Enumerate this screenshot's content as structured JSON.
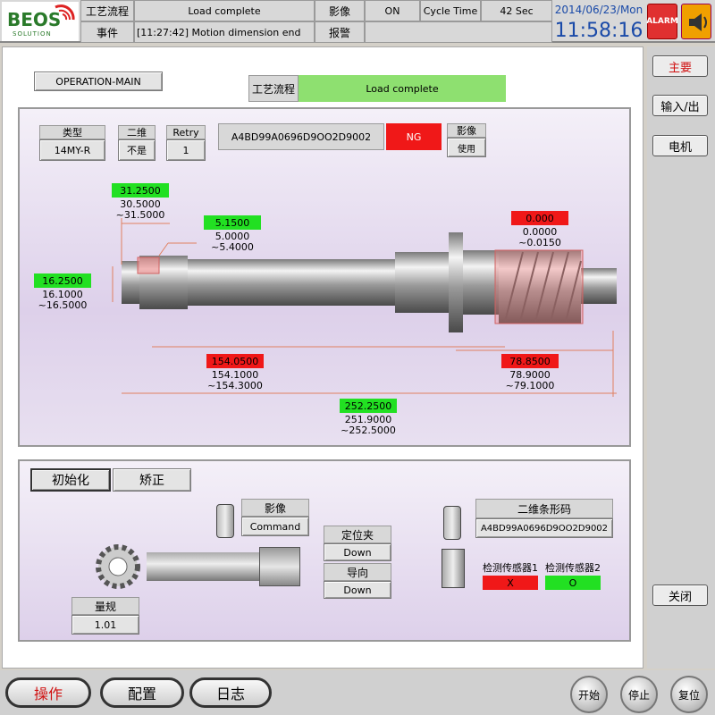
{
  "brand": {
    "logo": "BEOS",
    "sub": "SOLUTION"
  },
  "header": {
    "process_label": "工艺流程",
    "process_value": "Load complete",
    "image_label": "影像",
    "image_value": "ON",
    "cycle_label": "Cycle Time",
    "cycle_value": "42 Sec",
    "event_label": "事件",
    "event_value": "[11:27:42] Motion dimension end",
    "alarm_label": "报警",
    "date": "2014/06/23/Mon",
    "time": "11:58:16",
    "alarm_button": "ALARM"
  },
  "sidebar": {
    "main": "主要",
    "io": "输入/出",
    "motor": "电机",
    "close": "关闭"
  },
  "main": {
    "operation_label": "OPERATION-MAIN",
    "process_label": "工艺流程",
    "process_value": "Load complete",
    "type_label": "类型",
    "type_value": "14MY-R",
    "code2d_label": "二维",
    "code2d_value": "不是",
    "retry_label": "Retry",
    "retry_value": "1",
    "barcode": "A4BD99A0696D9OO2D9002",
    "result": "NG",
    "image_label": "影像",
    "image_value": "使用"
  },
  "measurements": {
    "m1": {
      "value": "31.2500",
      "min": "30.5000",
      "max": "~31.5000",
      "color": "#22e022"
    },
    "m2": {
      "value": "5.1500",
      "min": "5.0000",
      "max": "~5.4000",
      "color": "#22e022"
    },
    "m3": {
      "value": "16.2500",
      "min": "16.1000",
      "max": "~16.5000",
      "color": "#22e022"
    },
    "m4": {
      "value": "0.000",
      "min": "0.0000",
      "max": "~0.0150",
      "color": "#f01818"
    },
    "m5": {
      "value": "154.0500",
      "min": "154.1000",
      "max": "~154.3000",
      "color": "#f01818"
    },
    "m6": {
      "value": "78.8500",
      "min": "78.9000",
      "max": "~79.1000",
      "color": "#f01818"
    },
    "m7": {
      "value": "252.2500",
      "min": "251.9000",
      "max": "~252.5000",
      "color": "#22e022"
    }
  },
  "lower": {
    "tab_init": "初始化",
    "tab_correct": "矫正",
    "image_label": "影像",
    "image_value": "Command",
    "locate_label": "定位夹",
    "locate_value": "Down",
    "guide_label": "导向",
    "guide_value": "Down",
    "gauge_label": "量规",
    "gauge_value": "1.01",
    "barcode_label": "二维条形码",
    "barcode_value": "A4BD99A0696D9OO2D9002",
    "sensor1_label": "检测传感器1",
    "sensor1_value": "X",
    "sensor2_label": "检测传感器2",
    "sensor2_value": "O"
  },
  "footer": {
    "operate": "操作",
    "config": "配置",
    "log": "日志",
    "start": "开始",
    "stop": "停止",
    "reset": "复位"
  }
}
